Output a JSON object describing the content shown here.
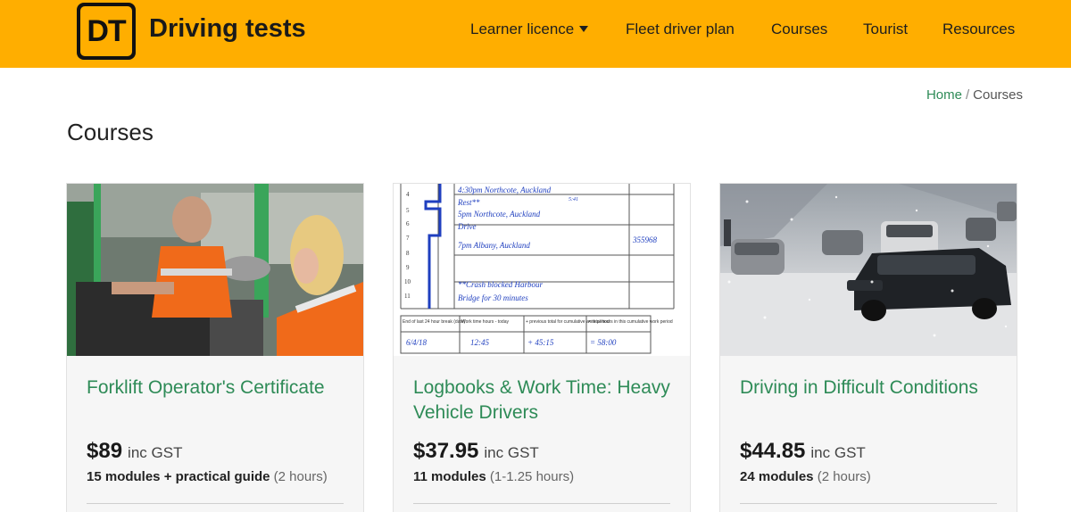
{
  "header": {
    "logo_text": "DT",
    "brand": "Driving tests",
    "nav": [
      {
        "label": "Learner licence",
        "dropdown": true
      },
      {
        "label": "Fleet driver plan"
      },
      {
        "label": "Courses"
      },
      {
        "label": "Tourist"
      },
      {
        "label": "Resources"
      }
    ]
  },
  "breadcrumb": {
    "home": "Home",
    "separator": "/",
    "current": "Courses"
  },
  "page_title": "Courses",
  "courses": [
    {
      "title": "Forklift Operator's Certificate",
      "price": "$89",
      "tax": "inc GST",
      "modules": "15 modules + practical guide",
      "duration": "(2 hours)"
    },
    {
      "title": "Logbooks & Work Time: Heavy Vehicle Drivers",
      "price": "$37.95",
      "tax": "inc GST",
      "modules": "11 modules",
      "duration": "(1-1.25 hours)",
      "logbook": {
        "rows": [
          "4:30pm Northcote, Auckland",
          "Rest**",
          "5pm Northcote, Auckland",
          "Drive",
          "7pm Albany, Auckland",
          "**Crash blocked Harbour",
          "Bridge for 30 minutes"
        ],
        "odometer": "355968",
        "small_note": "5:41",
        "hours": [
          "4",
          "5",
          "6",
          "7",
          "8",
          "9",
          "10",
          "11"
        ],
        "table_headers": [
          "End of last 24 hour break (date)",
          "Work time hours - today",
          "+ previous total for cumulative work period",
          "= total hours in this cumulative work period"
        ],
        "table_values": [
          "6/4/18",
          "12:45",
          "+ 45:15",
          "= 58:00"
        ]
      }
    },
    {
      "title": "Driving in Difficult Conditions",
      "price": "$44.85",
      "tax": "inc GST",
      "modules": "24 modules",
      "duration": "(2 hours)"
    }
  ],
  "colors": {
    "header_bg": "#ffae00",
    "link_green": "#2e8b57",
    "vest_orange": "#f06a1a",
    "machine_green": "#3aa55a"
  }
}
